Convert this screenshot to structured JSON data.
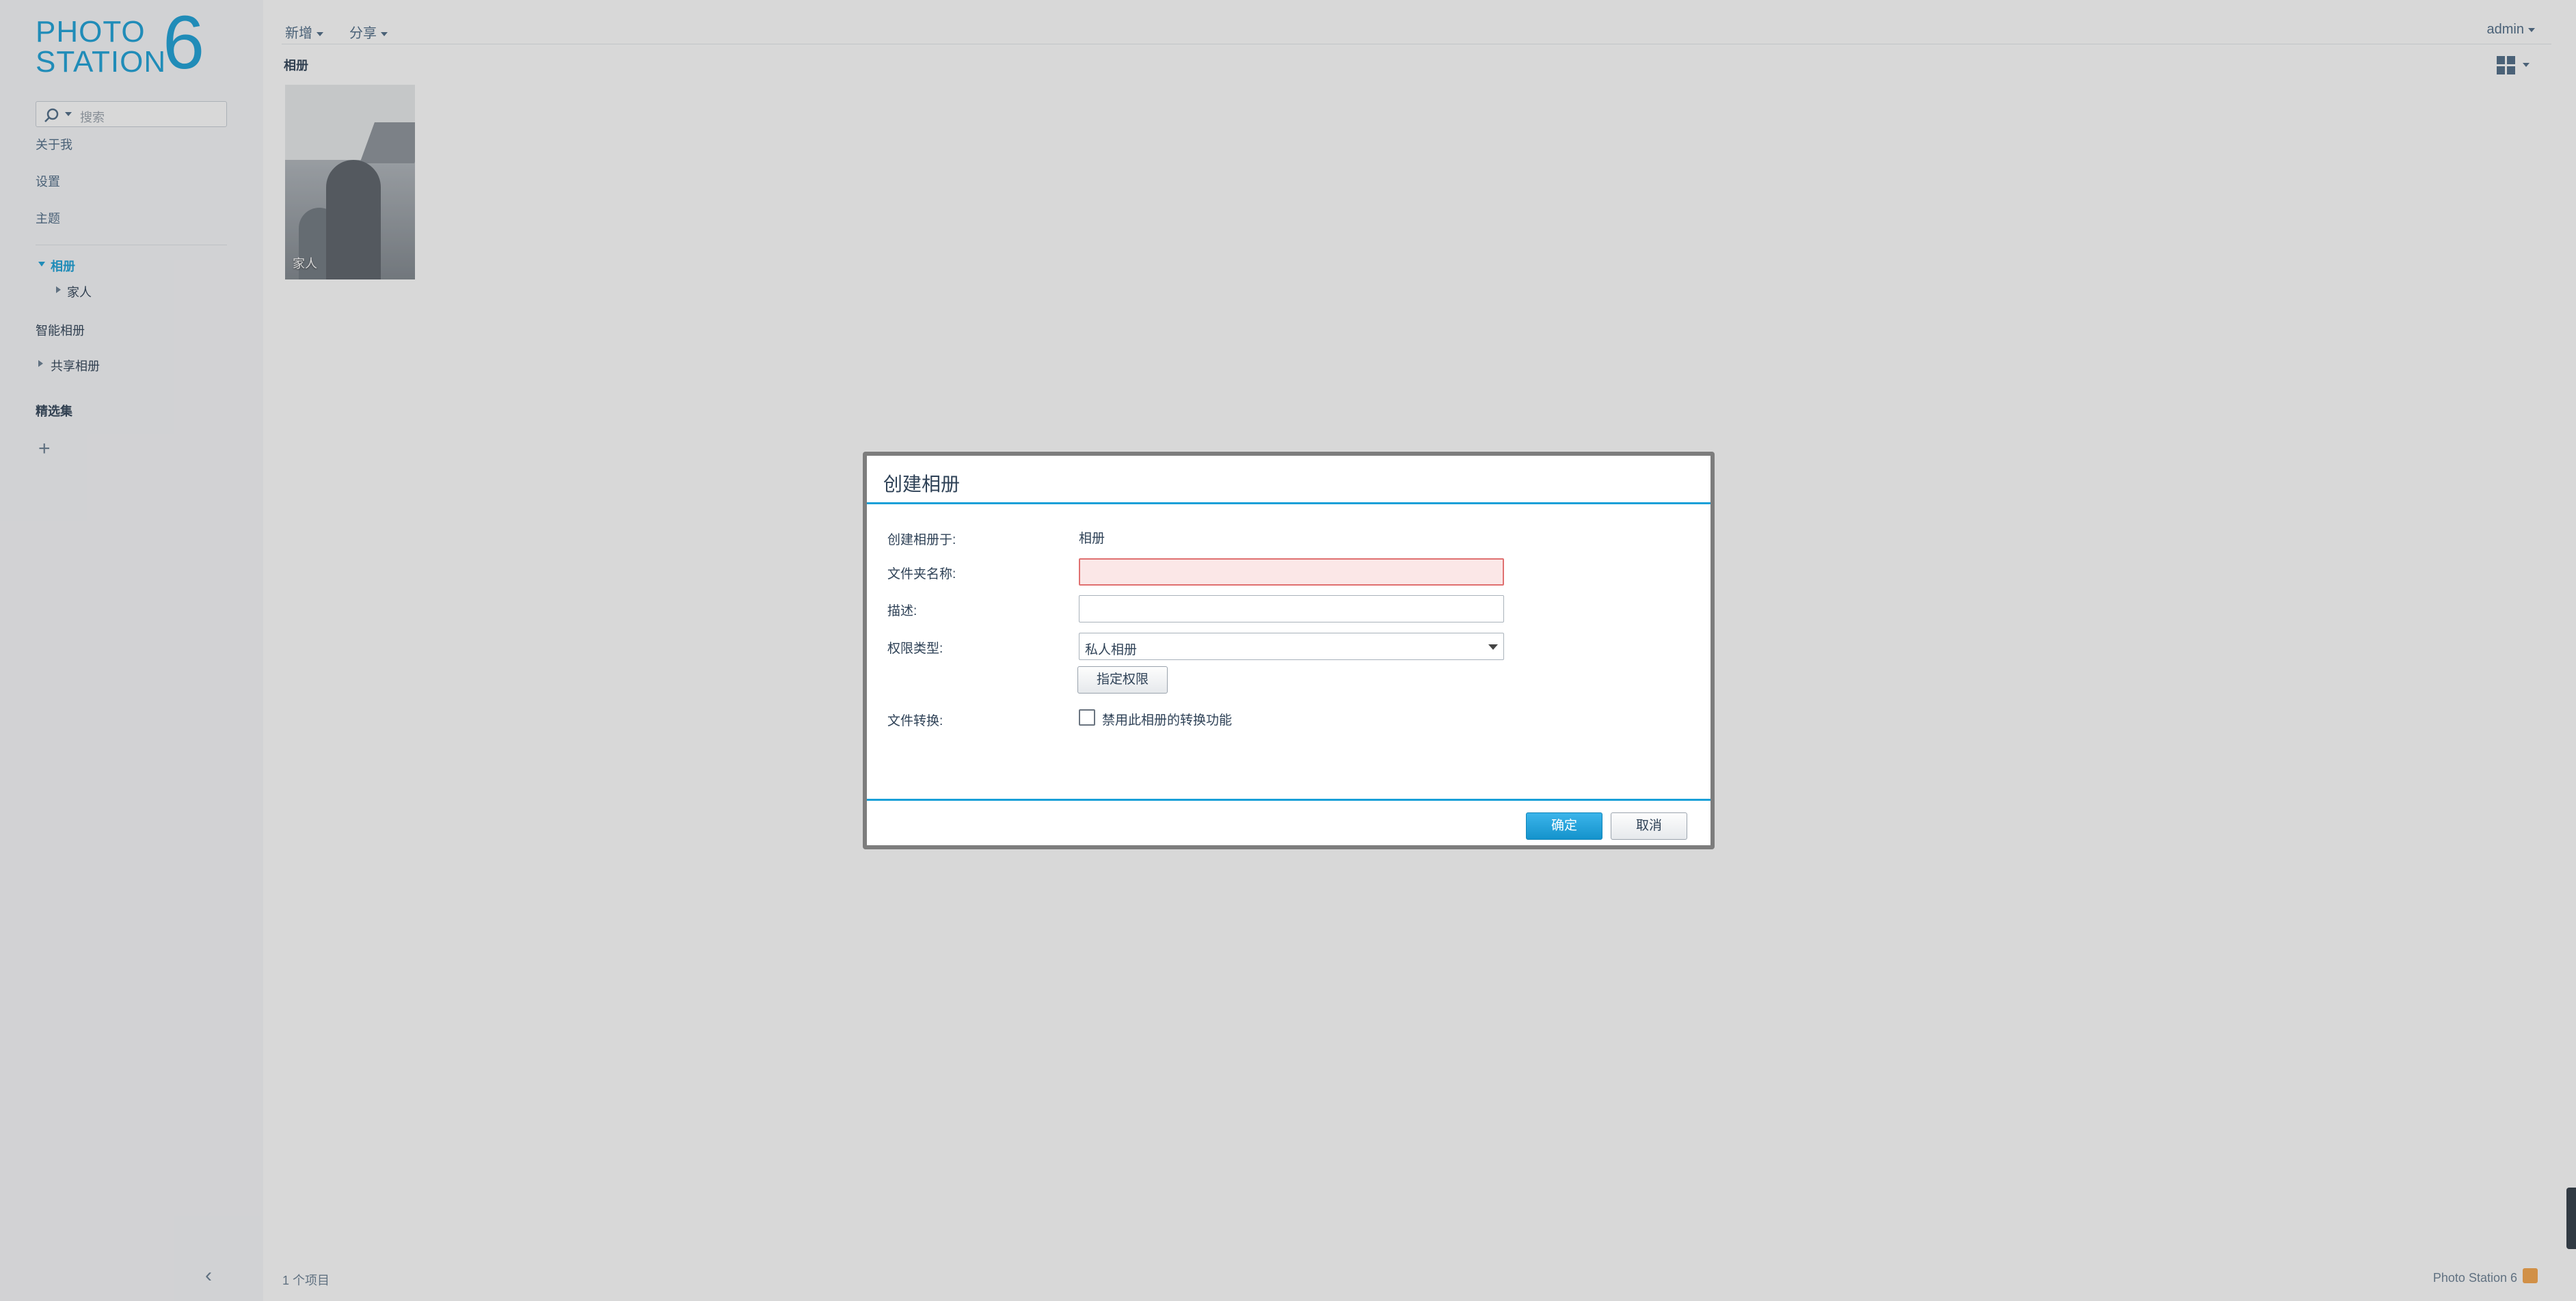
{
  "app": {
    "logo": {
      "line1": "PHOTO",
      "line2": "STATION",
      "version_digit": "6"
    },
    "search": {
      "placeholder": "搜索"
    },
    "sidebar": {
      "links": [
        "关于我",
        "设置",
        "主题"
      ],
      "albums_section": "相册",
      "album_children": [
        "家人"
      ],
      "smart_albums": "智能相册",
      "shared_albums": "共享相册",
      "selections": "精选集",
      "add_label": "+"
    },
    "topbar": {
      "new_label": "新增",
      "share_label": "分享",
      "user": "admin"
    },
    "breadcrumb": "相册",
    "album_card": {
      "name": "家人"
    },
    "footer": {
      "item_count": "1 个项目",
      "brand": "Photo Station 6"
    }
  },
  "dialog": {
    "title": "创建相册",
    "fields": {
      "create_in_label": "创建相册于:",
      "create_in_value": "相册",
      "folder_name_label": "文件夹名称:",
      "folder_name_value": "",
      "description_label": "描述:",
      "description_value": "",
      "permission_type_label": "权限类型:",
      "permission_type_value": "私人相册",
      "assign_permission_button": "指定权限",
      "file_conversion_label": "文件转换:",
      "disable_conversion_label": "禁用此相册的转换功能",
      "disable_conversion_checked": false
    },
    "buttons": {
      "ok": "确定",
      "cancel": "取消"
    }
  },
  "colors": {
    "accent": "#1aa0d8",
    "error_border": "#e07070",
    "error_fill": "#fbe7e7",
    "overlay": "rgba(60,60,60,0.20)"
  }
}
